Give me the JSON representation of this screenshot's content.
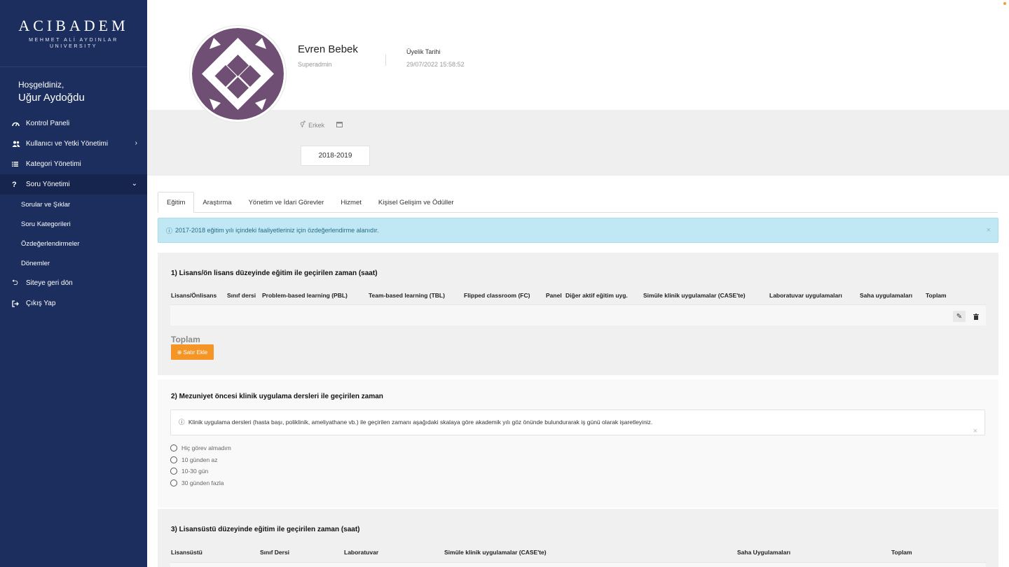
{
  "brand": {
    "name": "ACIBADEM",
    "line1": "MEHMET ALİ AYDINLAR",
    "line2": "UNIVERSITY"
  },
  "welcome": {
    "greeting": "Hoşgeldiniz,",
    "user_name": "Uğur Aydoğdu"
  },
  "menu": {
    "items": [
      {
        "label": "Kontrol Paneli",
        "icon": "dashboard-icon"
      },
      {
        "label": "Kullanıcı ve Yetki Yönetimi",
        "icon": "users-icon"
      },
      {
        "label": "Kategori Yönetimi",
        "icon": "list-icon"
      },
      {
        "label": "Soru Yönetimi",
        "icon": "question-icon"
      }
    ],
    "sub_items": [
      "Sorular ve Şıklar",
      "Soru Kategorileri",
      "Özdeğerlendirmeler",
      "Dönemler"
    ],
    "bottom_items": [
      {
        "label": "Siteye geri dön",
        "icon": "return-icon"
      },
      {
        "label": "Çıkış Yap",
        "icon": "logout-icon"
      }
    ]
  },
  "profile": {
    "name": "Evren Bebek",
    "role": "Superadmin",
    "member_label": "Üyelik Tarihi",
    "member_date": "29/07/2022 15:58:52",
    "gender": "Erkek",
    "year": "2018-2019"
  },
  "tabs": [
    "Eğitim",
    "Araştırma",
    "Yönetim ve İdari Görevler",
    "Hizmet",
    "Kişisel Gelişim ve Ödüller"
  ],
  "alert": {
    "text": "2017-2018 eğitim yılı içindeki faaliyetleriniz için özdeğerlendirme alanıdır."
  },
  "section1": {
    "title": "1) Lisans/ön lisans düzeyinde eğitim ile geçirilen zaman (saat)",
    "columns": [
      "Lisans/Önlisans",
      "Sınıf dersi",
      "Problem-based learning (PBL)",
      "Team-based learning (TBL)",
      "Flipped classroom (FC)",
      "Panel",
      "Diğer aktif eğitim uyg.",
      "Simüle klinik uygulamalar (CASE'te)",
      "Laboratuvar uygulamaları",
      "Saha uygulamaları",
      "Toplam"
    ],
    "total_label": "Toplam",
    "add_row_label": "Satır Ekle"
  },
  "section2": {
    "title": "2) Mezuniyet öncesi klinik uygulama dersleri ile geçirilen zaman",
    "note": "Klinik uygulama dersleri (hasta başı, poliklinik, ameliyathane vb.) ile geçirilen zamanı aşağıdaki skalaya göre akademik yılı göz önünde bulundurarak iş günü olarak işaretleyiniz.",
    "options": [
      "Hiç görev almadım",
      "10 günden az",
      "10-30 gün",
      "30 günden fazla"
    ]
  },
  "section3": {
    "title": "3) Lisansüstü düzeyinde eğitim ile geçirilen zaman (saat)",
    "columns": [
      "Lisansüstü",
      "Sınıf Dersi",
      "Laboratuvar",
      "Simüle klinik uygulamalar (CASE'te)",
      "Saha Uygulamaları",
      "Toplam"
    ]
  },
  "colors": {
    "sidebar": "#1c2e5e",
    "accent": "#f59525",
    "alert_bg": "#bfe7f4",
    "avatar_fill": "#6f4f73"
  }
}
